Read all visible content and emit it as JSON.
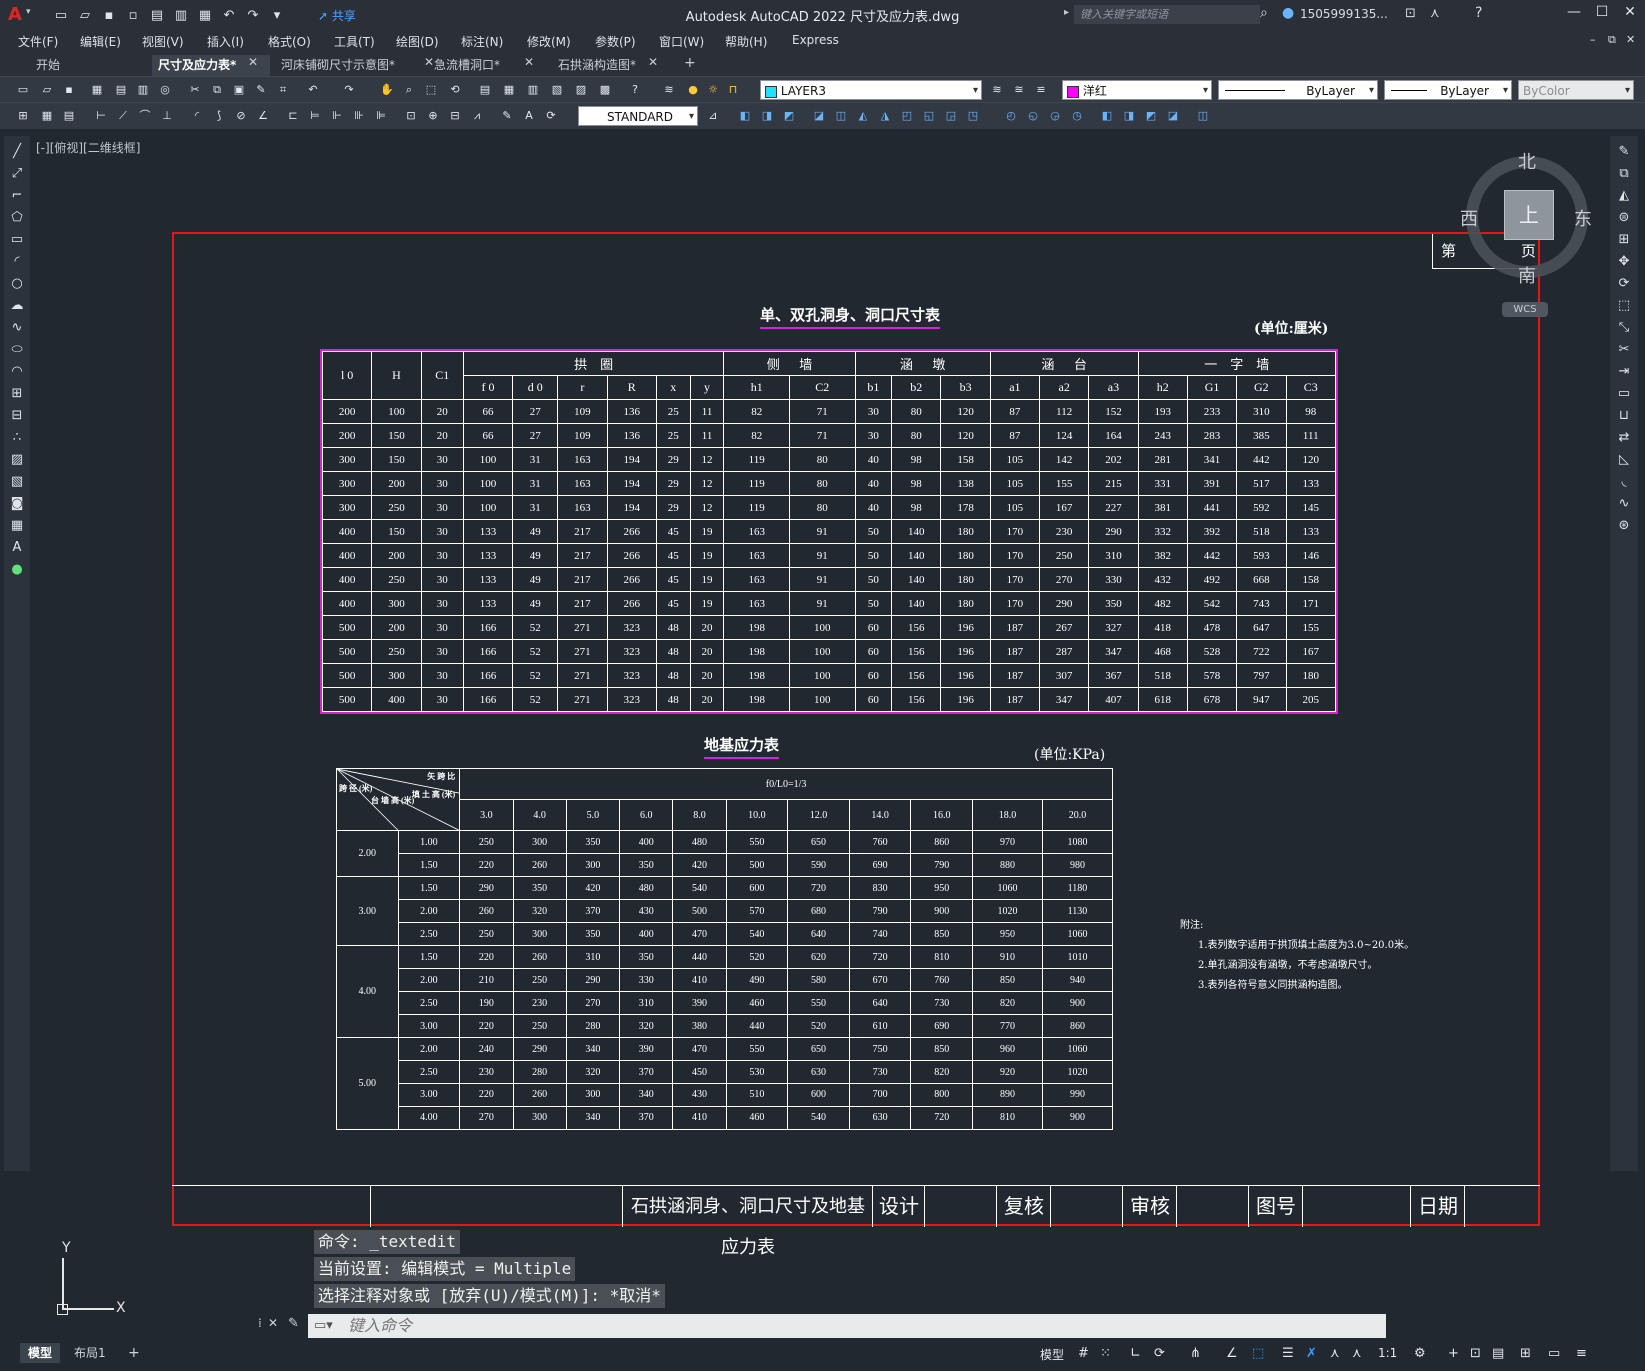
{
  "title_bar": {
    "app_title": "Autodesk AutoCAD 2022    尺寸及应力表.dwg",
    "share_label": "共享",
    "search_placeholder": "键入关键字或短语",
    "user": "1505999135...",
    "logo": "A"
  },
  "menu": [
    "文件(F)",
    "编辑(E)",
    "视图(V)",
    "插入(I)",
    "格式(O)",
    "工具(T)",
    "绘图(D)",
    "标注(N)",
    "修改(M)",
    "参数(P)",
    "窗口(W)",
    "帮助(H)",
    "Express"
  ],
  "tabs": [
    "开始",
    "尺寸及应力表*",
    "河床铺砌尺寸示意图*",
    "急流槽洞口*",
    "石拱涵构造图*"
  ],
  "active_tab": "尺寸及应力表*",
  "toolbar": {
    "layer": "LAYER3",
    "color": "洋红",
    "color_hex": "#ff00ff",
    "linetype": "ByLayer",
    "lineweight": "ByLayer",
    "plotstyle": "ByColor",
    "dimstyle": "STANDARD"
  },
  "viewport_label": "[-][俯视][二维线框]",
  "compass": {
    "north": "北",
    "south": "南",
    "east": "东",
    "west": "西",
    "top": "上",
    "wcs": "WCS"
  },
  "page_box": {
    "left": "第",
    "right": "页"
  },
  "table1": {
    "title": "单、双孔洞身、洞口尺寸表",
    "unit": "(单位:厘米)",
    "group_headers": [
      "拱    圈",
      "侧      墙",
      "涵      墩",
      "涵      台",
      "一    字    墙"
    ],
    "fixed_headers": [
      "l 0",
      "H",
      "C1"
    ],
    "sub_headers": [
      "f 0",
      "d 0",
      "r",
      "R",
      "x",
      "y",
      "h1",
      "C2",
      "b1",
      "b2",
      "b3",
      "a1",
      "a2",
      "a3",
      "h2",
      "G1",
      "G2",
      "C3"
    ],
    "rows": [
      [
        "200",
        "100",
        "20",
        "66",
        "27",
        "109",
        "136",
        "25",
        "11",
        "82",
        "71",
        "30",
        "80",
        "120",
        "87",
        "112",
        "152",
        "193",
        "233",
        "310",
        "98"
      ],
      [
        "200",
        "150",
        "20",
        "66",
        "27",
        "109",
        "136",
        "25",
        "11",
        "82",
        "71",
        "30",
        "80",
        "120",
        "87",
        "124",
        "164",
        "243",
        "283",
        "385",
        "111"
      ],
      [
        "300",
        "150",
        "30",
        "100",
        "31",
        "163",
        "194",
        "29",
        "12",
        "119",
        "80",
        "40",
        "98",
        "158",
        "105",
        "142",
        "202",
        "281",
        "341",
        "442",
        "120"
      ],
      [
        "300",
        "200",
        "30",
        "100",
        "31",
        "163",
        "194",
        "29",
        "12",
        "119",
        "80",
        "40",
        "98",
        "138",
        "105",
        "155",
        "215",
        "331",
        "391",
        "517",
        "133"
      ],
      [
        "300",
        "250",
        "30",
        "100",
        "31",
        "163",
        "194",
        "29",
        "12",
        "119",
        "80",
        "40",
        "98",
        "178",
        "105",
        "167",
        "227",
        "381",
        "441",
        "592",
        "145"
      ],
      [
        "400",
        "150",
        "30",
        "133",
        "49",
        "217",
        "266",
        "45",
        "19",
        "163",
        "91",
        "50",
        "140",
        "180",
        "170",
        "230",
        "290",
        "332",
        "392",
        "518",
        "133"
      ],
      [
        "400",
        "200",
        "30",
        "133",
        "49",
        "217",
        "266",
        "45",
        "19",
        "163",
        "91",
        "50",
        "140",
        "180",
        "170",
        "250",
        "310",
        "382",
        "442",
        "593",
        "146"
      ],
      [
        "400",
        "250",
        "30",
        "133",
        "49",
        "217",
        "266",
        "45",
        "19",
        "163",
        "91",
        "50",
        "140",
        "180",
        "170",
        "270",
        "330",
        "432",
        "492",
        "668",
        "158"
      ],
      [
        "400",
        "300",
        "30",
        "133",
        "49",
        "217",
        "266",
        "45",
        "19",
        "163",
        "91",
        "50",
        "140",
        "180",
        "170",
        "290",
        "350",
        "482",
        "542",
        "743",
        "171"
      ],
      [
        "500",
        "200",
        "30",
        "166",
        "52",
        "271",
        "323",
        "48",
        "20",
        "198",
        "100",
        "60",
        "156",
        "196",
        "187",
        "267",
        "327",
        "418",
        "478",
        "647",
        "155"
      ],
      [
        "500",
        "250",
        "30",
        "166",
        "52",
        "271",
        "323",
        "48",
        "20",
        "198",
        "100",
        "60",
        "156",
        "196",
        "187",
        "287",
        "347",
        "468",
        "528",
        "722",
        "167"
      ],
      [
        "500",
        "300",
        "30",
        "166",
        "52",
        "271",
        "323",
        "48",
        "20",
        "198",
        "100",
        "60",
        "156",
        "196",
        "187",
        "307",
        "367",
        "518",
        "578",
        "797",
        "180"
      ],
      [
        "500",
        "400",
        "30",
        "166",
        "52",
        "271",
        "323",
        "48",
        "20",
        "198",
        "100",
        "60",
        "156",
        "196",
        "187",
        "347",
        "407",
        "618",
        "678",
        "947",
        "205"
      ]
    ]
  },
  "table2": {
    "title": "地基应力表",
    "unit": "(单位:KPa)",
    "ratio_header": "f0/L0=1/3",
    "corner": {
      "a": "矢 跨 比",
      "b": "填 土 高 (米)",
      "c": "台 墙 高 (米)",
      "d": "跨 径 (米)"
    },
    "ratios": [
      "3.0",
      "4.0",
      "5.0",
      "6.0",
      "8.0",
      "10.0",
      "12.0",
      "14.0",
      "16.0",
      "18.0",
      "20.0"
    ],
    "groups": [
      {
        "span": "2.00",
        "rows": [
          [
            "1.00",
            "250",
            "300",
            "350",
            "400",
            "480",
            "550",
            "650",
            "760",
            "860",
            "970",
            "1080"
          ],
          [
            "1.50",
            "220",
            "260",
            "300",
            "350",
            "420",
            "500",
            "590",
            "690",
            "790",
            "880",
            "980"
          ]
        ]
      },
      {
        "span": "3.00",
        "rows": [
          [
            "1.50",
            "290",
            "350",
            "420",
            "480",
            "540",
            "600",
            "720",
            "830",
            "950",
            "1060",
            "1180"
          ],
          [
            "2.00",
            "260",
            "320",
            "370",
            "430",
            "500",
            "570",
            "680",
            "790",
            "900",
            "1020",
            "1130"
          ],
          [
            "2.50",
            "250",
            "300",
            "350",
            "400",
            "470",
            "540",
            "640",
            "740",
            "850",
            "950",
            "1060"
          ]
        ]
      },
      {
        "span": "4.00",
        "rows": [
          [
            "1.50",
            "220",
            "260",
            "310",
            "350",
            "440",
            "520",
            "620",
            "720",
            "810",
            "910",
            "1010"
          ],
          [
            "2.00",
            "210",
            "250",
            "290",
            "330",
            "410",
            "490",
            "580",
            "670",
            "760",
            "850",
            "940"
          ],
          [
            "2.50",
            "190",
            "230",
            "270",
            "310",
            "390",
            "460",
            "550",
            "640",
            "730",
            "820",
            "900"
          ],
          [
            "3.00",
            "220",
            "250",
            "280",
            "320",
            "380",
            "440",
            "520",
            "610",
            "690",
            "770",
            "860"
          ]
        ]
      },
      {
        "span": "5.00",
        "rows": [
          [
            "2.00",
            "240",
            "290",
            "340",
            "390",
            "470",
            "550",
            "650",
            "750",
            "850",
            "960",
            "1060"
          ],
          [
            "2.50",
            "230",
            "280",
            "320",
            "370",
            "450",
            "530",
            "630",
            "730",
            "820",
            "920",
            "1020"
          ],
          [
            "3.00",
            "220",
            "260",
            "300",
            "340",
            "430",
            "510",
            "600",
            "700",
            "800",
            "890",
            "990"
          ],
          [
            "4.00",
            "270",
            "300",
            "340",
            "370",
            "410",
            "460",
            "540",
            "630",
            "720",
            "810",
            "900"
          ]
        ]
      }
    ]
  },
  "notes": {
    "heading": "附注:",
    "lines": [
      "1.表列数字适用于拱顶填土高度为3.0~20.0米。",
      "2.单孔涵洞没有涵墩，不考虑涵墩尺寸。",
      "3.表列各符号意义同拱涵构造图。"
    ]
  },
  "title_block": {
    "drawing_title": "石拱涵洞身、洞口尺寸及地基应力表",
    "design": "设计",
    "check": "复核",
    "review": "审核",
    "drawing_no": "图号",
    "date": "日期"
  },
  "ucs": {
    "x": "X",
    "y": "Y"
  },
  "command_history": [
    "命令: _textedit",
    "当前设置: 编辑模式 = Multiple",
    "选择注释对象或 [放弃(U)/模式(M)]: *取消*"
  ],
  "command_placeholder": "键入命令",
  "layout_tabs": [
    "模型",
    "布局1"
  ],
  "status": {
    "model": "模型",
    "scale": "1:1"
  }
}
